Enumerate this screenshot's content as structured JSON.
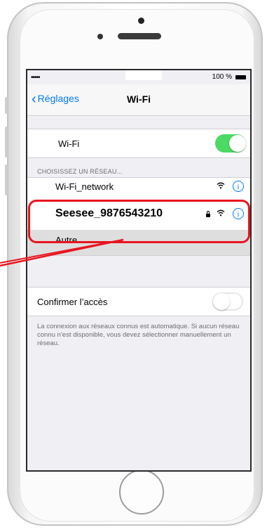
{
  "status_bar": {
    "signal": "•••••",
    "battery_percent": "100 %"
  },
  "nav": {
    "back_label": "Réglages",
    "title": "Wi-Fi"
  },
  "wifi_toggle": {
    "label": "Wi-Fi",
    "state": "on"
  },
  "networks": {
    "section_header": "CHOISISSEZ UN RÉSEAU...",
    "items": [
      {
        "name": "Wi-Fi_network",
        "secured": false
      },
      {
        "name": "Seesee_9876543210",
        "secured": true
      }
    ],
    "other_label": "Autre..."
  },
  "confirm_access": {
    "label": "Confirmer l’accès",
    "state": "off"
  },
  "footer_note": "La connexion aux réseaux connus est automatique. Si aucun réseau connu n’est disponible, vous devez sélectionner manuellement un réseau.",
  "colors": {
    "accent": "#007aff",
    "toggle_on": "#4cd964",
    "highlight": "#e8141e"
  }
}
